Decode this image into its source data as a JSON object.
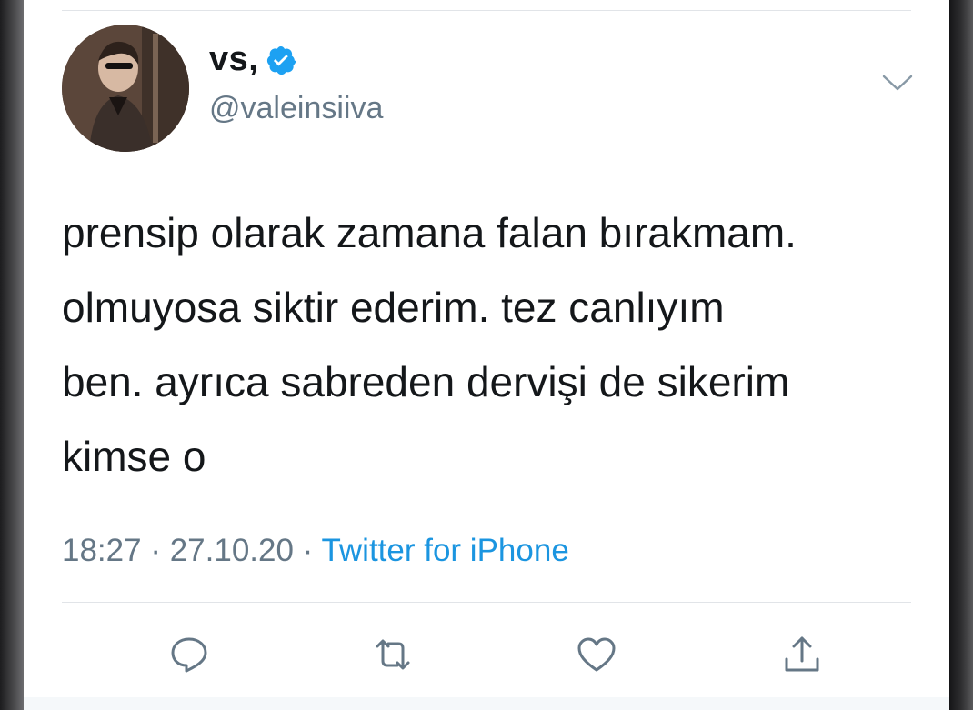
{
  "tweet": {
    "display_name": "vs,",
    "handle": "@valeinsiiva",
    "verified": true,
    "text_lines": [
      "prensip olarak zamana falan bırakmam.",
      "olmuyosa siktir ederim. tez canlıyım",
      "ben. ayrıca sabreden dervişi de sikerim",
      "kimse o"
    ],
    "time": "18:27",
    "separator": " · ",
    "date": "27.10.20",
    "source": "Twitter for iPhone"
  },
  "icons": {
    "verified": "verified-badge-icon",
    "more": "chevron-down-icon",
    "reply": "reply-icon",
    "retweet": "retweet-icon",
    "like": "heart-icon",
    "share": "share-icon"
  },
  "colors": {
    "text": "#14171a",
    "muted": "#657786",
    "link": "#1b95e0",
    "verified": "#1da1f2",
    "divider": "#e1e4e8"
  }
}
